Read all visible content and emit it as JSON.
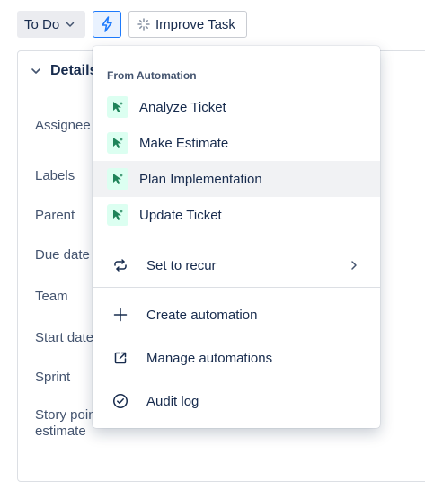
{
  "toolbar": {
    "status_label": "To Do",
    "improve_label": "Improve Task"
  },
  "details": {
    "header": "Details",
    "fields": [
      "Assignee",
      "Labels",
      "Parent",
      "Due date",
      "Team",
      "Start date",
      "Sprint",
      "Story point",
      "estimate"
    ]
  },
  "menu": {
    "section_title": "From Automation",
    "automations": [
      "Analyze Ticket",
      "Make Estimate",
      "Plan Implementation",
      "Update Ticket"
    ],
    "recur_label": "Set to recur",
    "create_label": "Create automation",
    "manage_label": "Manage automations",
    "audit_label": "Audit log"
  },
  "colors": {
    "accent": "#1d7afc",
    "automation_icon_bg": "#dcfff1",
    "automation_icon_fg": "#1f845a",
    "highlight": "#f1f2f4"
  }
}
